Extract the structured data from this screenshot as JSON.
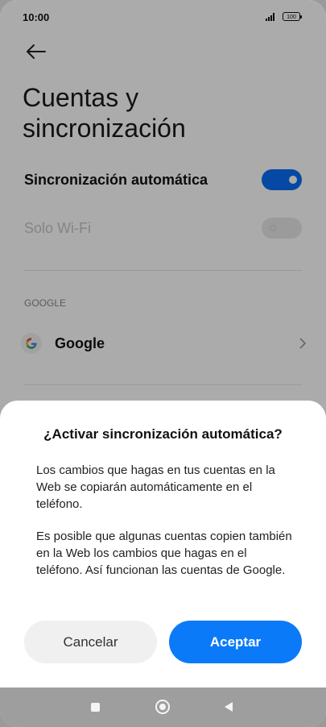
{
  "status_bar": {
    "time": "10:00",
    "battery": "100"
  },
  "page": {
    "title_line1": "Cuentas y",
    "title_line2": "sincronización"
  },
  "settings": {
    "auto_sync_label": "Sincronización automática",
    "auto_sync_on": true,
    "wifi_only_label": "Solo Wi-Fi",
    "wifi_only_on": false
  },
  "accounts": {
    "section_header": "GOOGLE",
    "items": [
      {
        "label": "Google",
        "icon": "google-g-icon"
      }
    ]
  },
  "dialog": {
    "title": "¿Activar sincronización automática?",
    "paragraph1": "Los cambios que hagas en tus cuentas en la Web se copiarán automáticamente en el teléfono.",
    "paragraph2": "Es posible que algunas cuentas copien también en la Web los cambios que hagas en el teléfono. Así funcionan las cuentas de Google.",
    "cancel_label": "Cancelar",
    "accept_label": "Aceptar"
  },
  "colors": {
    "accent": "#0a7af8",
    "toggle_on": "#0a6df5",
    "scrim": "rgba(0,0,0,0.33)"
  }
}
